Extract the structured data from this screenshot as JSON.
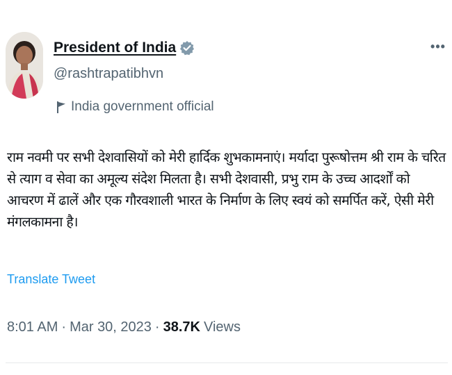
{
  "author": {
    "display_name": "President of India",
    "handle": "@rashtrapatibhvn",
    "label": "India government official"
  },
  "icons": {
    "avatar": "profile-photo",
    "verified": "verified-badge-icon",
    "label": "flag-icon",
    "more": "more-options-icon"
  },
  "colors": {
    "verified_badge": "#829aab",
    "link": "#1d9bf0",
    "secondary_text": "#536471",
    "primary_text": "#0f1419"
  },
  "tweet": {
    "text": "राम नवमी पर सभी देशवासियों को मेरी हार्दिक शुभकामनाएं। मर्यादा पुरूषोत्तम श्री राम के चरित से त्याग व सेवा का अमूल्य संदेश मिलता है। सभी देशवासी, प्रभु राम के उच्च आदर्शों को आचरण में ढालें और एक गौरवशाली भारत के निर्माण के लिए स्वयं को समर्पित करें, ऐसी मेरी मंगलकामना है।",
    "translate_label": "Translate Tweet"
  },
  "meta": {
    "time": "8:01 AM",
    "separator": "·",
    "date": "Mar 30, 2023",
    "separator2": "·",
    "views_count": "38.7K",
    "views_label": "Views"
  }
}
